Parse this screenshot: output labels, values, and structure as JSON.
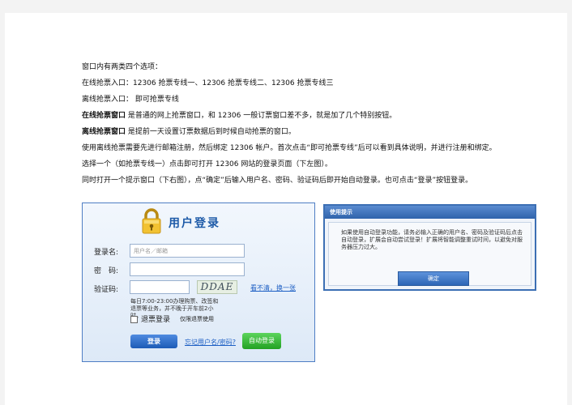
{
  "document": {
    "lines": [
      {
        "text": "窗口内有两类四个选项："
      },
      {
        "text": "在线抢票入口：12306 抢票专线一、12306 抢票专线二、12306 抢票专线三"
      },
      {
        "text": "离线抢票入口：  即可抢票专线"
      },
      {
        "bold": "在线抢票窗口",
        "text": "  是普通的网上抢票窗口，和 12306 一般订票窗口差不多，就是加了几个特别按钮。"
      },
      {
        "bold": "离线抢票窗口",
        "text": "  是提前一天设置订票数据后到时候自动抢票的窗口。"
      },
      {
        "text": "使用离线抢票需要先进行邮箱注册，然后绑定 12306 帐户。首次点击“即可抢票专线”后可以看到具体说明，并进行注册和绑定。"
      },
      {
        "text": "选择一个（如抢票专线一）点击即可打开  12306 网站的登录页面（下左图）。"
      },
      {
        "text": "同时打开一个提示窗口（下右图），点“确定”后输入用户名、密码、验证码后即开始自动登录。也可点击“登录”按钮登录。"
      }
    ]
  },
  "login": {
    "title": "用户登录",
    "username_label": "登录名:",
    "username_placeholder": "用户名／邮箱",
    "password_label": "密　码:",
    "captcha_label": "验证码:",
    "captcha_text": "DDAE",
    "refresh_link": "看不清，换一张",
    "notice": "每日7:00-23:00办理购票、改签和退票等业务，并不晚于开车前2小时。",
    "refund_checkbox_label": "退票登录",
    "refund_note": "仅限退票使用",
    "login_button": "登录",
    "forgot_link": "忘记用户名/密码?",
    "auto_login_button": "自动登录"
  },
  "dialog": {
    "title": "使用提示",
    "message": "如果使用自动登录功能，请务必输入正确的用户名、密码及验证码后点击自动登录，扩展会自动尝试登录！扩展将智能调整重试时间，以避免对服务器压力过大。",
    "ok_button": "确定"
  }
}
